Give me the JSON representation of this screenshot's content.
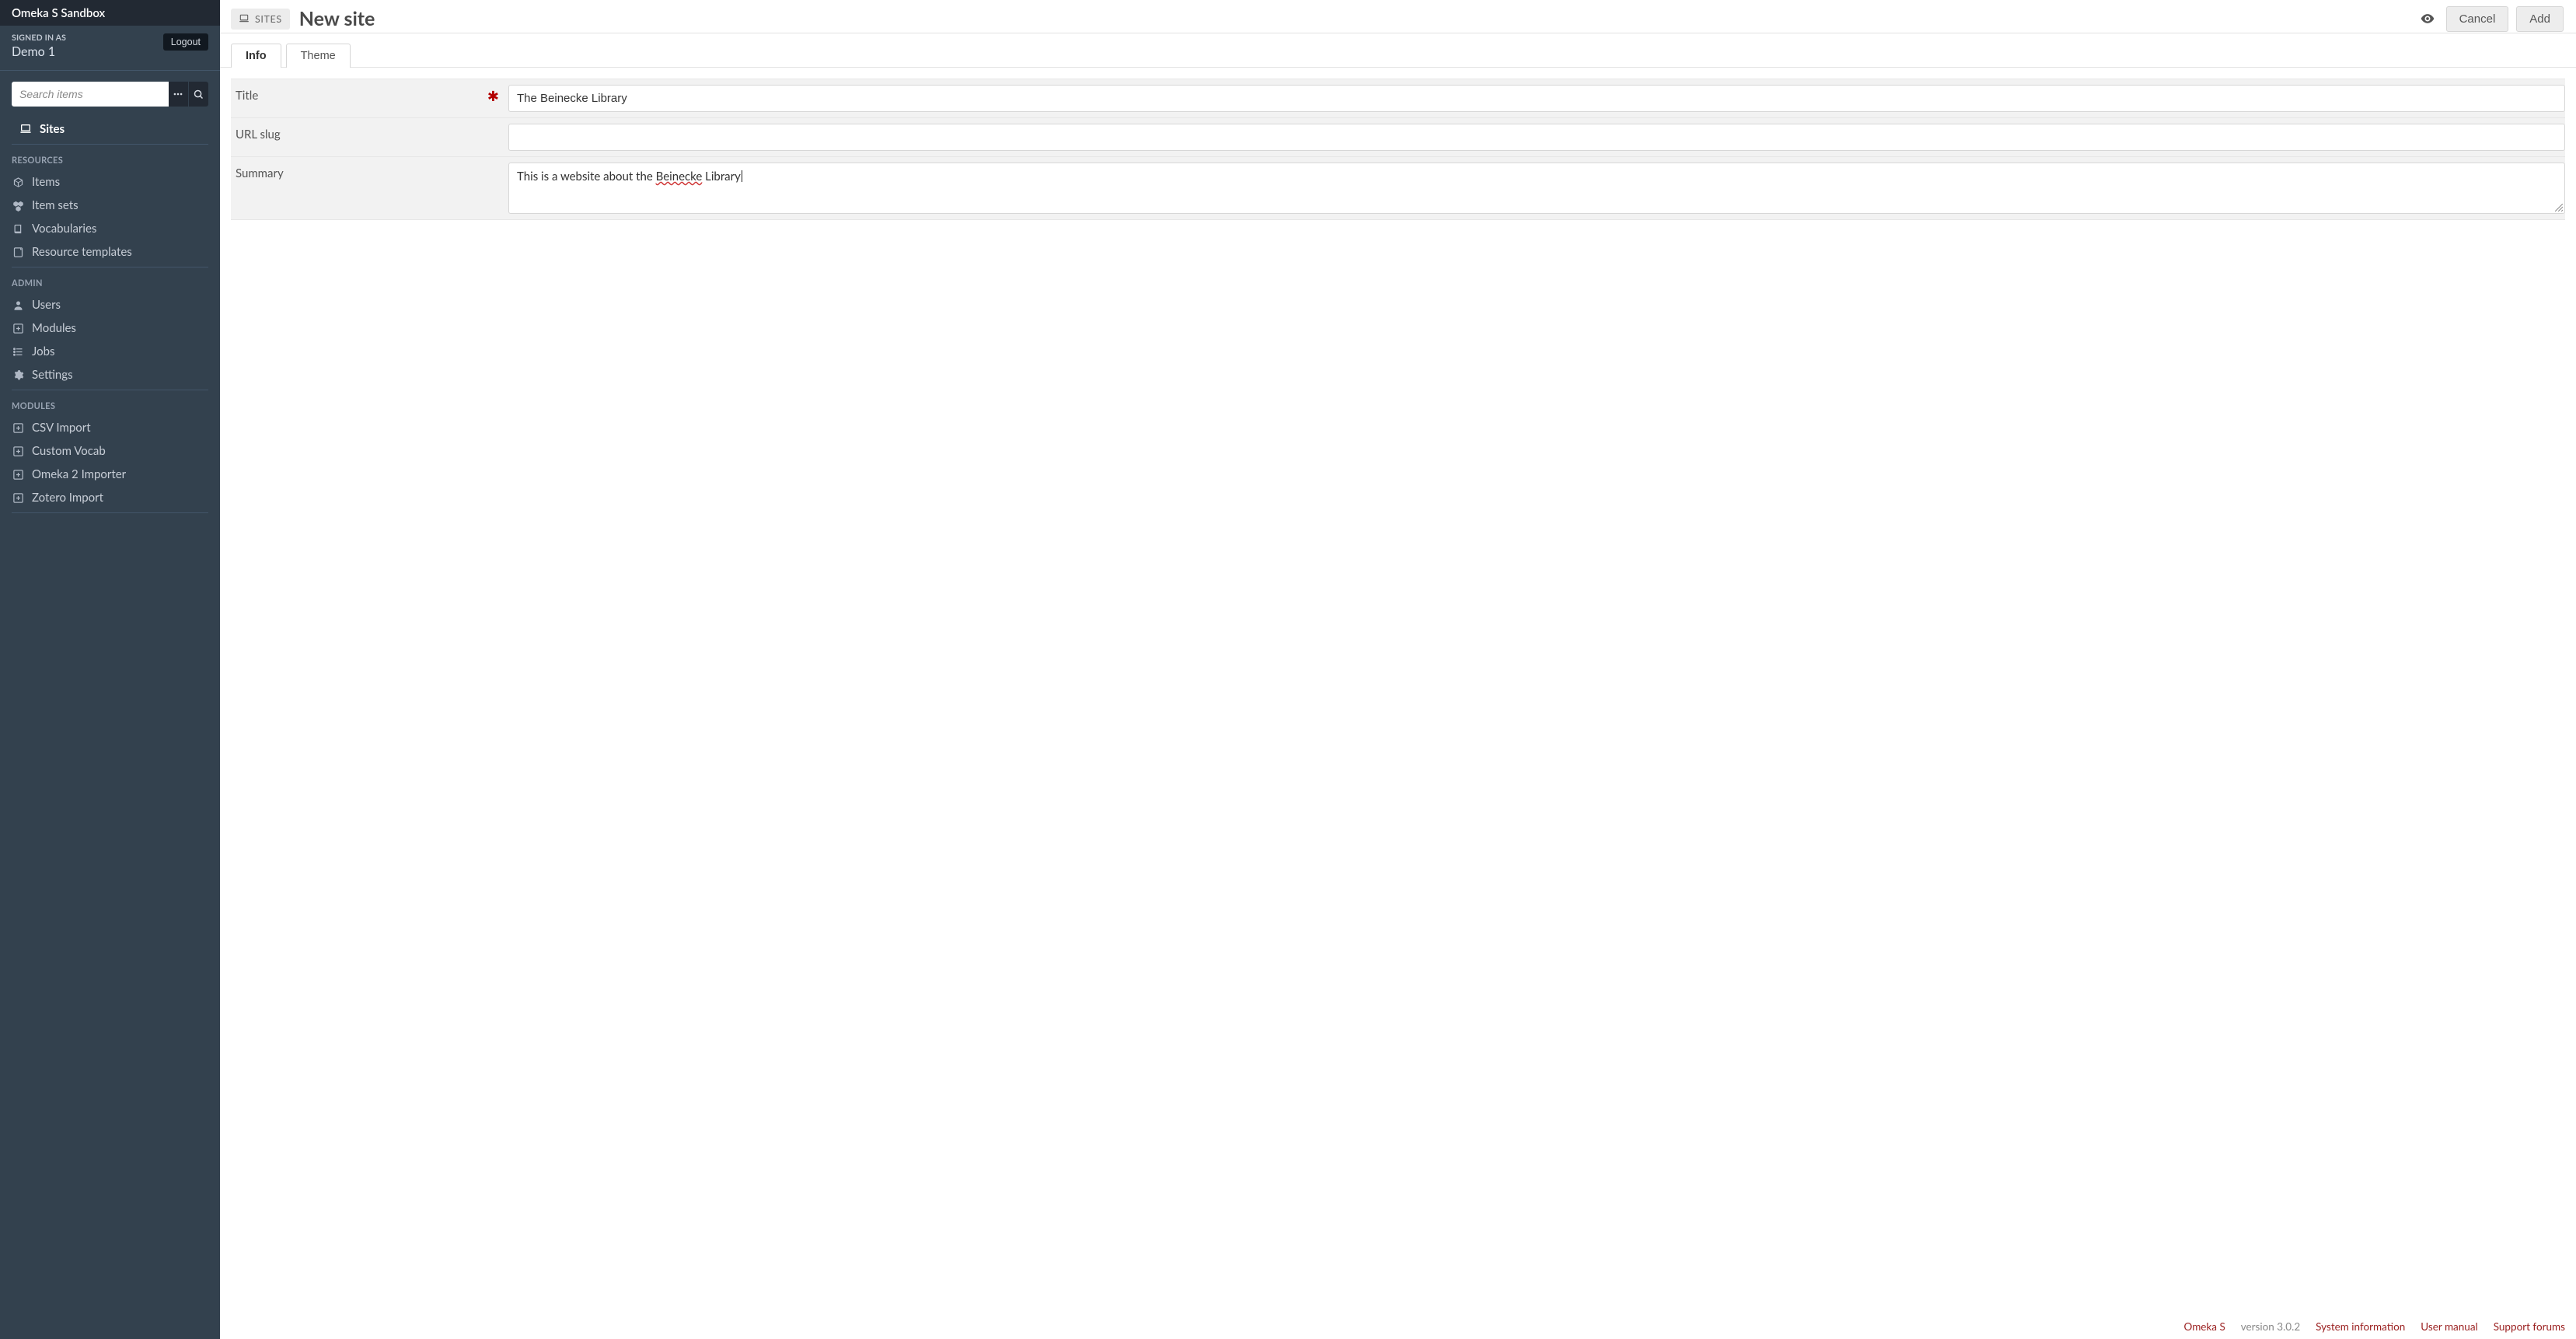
{
  "brand": "Omeka S Sandbox",
  "user": {
    "signed_in_label": "SIGNED IN AS",
    "name": "Demo 1",
    "logout_label": "Logout"
  },
  "search": {
    "placeholder": "Search items"
  },
  "nav": {
    "sites_label": "Sites",
    "sections": [
      {
        "title": "RESOURCES",
        "items": [
          {
            "id": "items",
            "label": "Items",
            "icon": "cube"
          },
          {
            "id": "item-sets",
            "label": "Item sets",
            "icon": "cubes"
          },
          {
            "id": "vocabularies",
            "label": "Vocabularies",
            "icon": "book"
          },
          {
            "id": "resource-templates",
            "label": "Resource templates",
            "icon": "note"
          }
        ]
      },
      {
        "title": "ADMIN",
        "items": [
          {
            "id": "users",
            "label": "Users",
            "icon": "user"
          },
          {
            "id": "modules",
            "label": "Modules",
            "icon": "plus-square"
          },
          {
            "id": "jobs",
            "label": "Jobs",
            "icon": "list"
          },
          {
            "id": "settings",
            "label": "Settings",
            "icon": "cogs"
          }
        ]
      },
      {
        "title": "MODULES",
        "items": [
          {
            "id": "csv-import",
            "label": "CSV Import",
            "icon": "plus-square"
          },
          {
            "id": "custom-vocab",
            "label": "Custom Vocab",
            "icon": "plus-square"
          },
          {
            "id": "omeka2-importer",
            "label": "Omeka 2 Importer",
            "icon": "plus-square"
          },
          {
            "id": "zotero-import",
            "label": "Zotero Import",
            "icon": "plus-square"
          }
        ]
      }
    ]
  },
  "header": {
    "breadcrumb": "SITES",
    "title": "New site",
    "cancel_label": "Cancel",
    "add_label": "Add"
  },
  "tabs": [
    {
      "id": "info",
      "label": "Info",
      "active": true
    },
    {
      "id": "theme",
      "label": "Theme",
      "active": false
    }
  ],
  "form": {
    "title": {
      "label": "Title",
      "required": true,
      "value": "The Beinecke Library"
    },
    "slug": {
      "label": "URL slug",
      "required": false,
      "value": ""
    },
    "summary": {
      "label": "Summary",
      "required": false,
      "value_pre": "This is a website about the ",
      "value_underlined": "Beinecke",
      "value_post": " Library"
    }
  },
  "footer": {
    "omeka_link": "Omeka S",
    "version": "version 3.0.2",
    "links": [
      "System information",
      "User manual",
      "Support forums"
    ]
  }
}
